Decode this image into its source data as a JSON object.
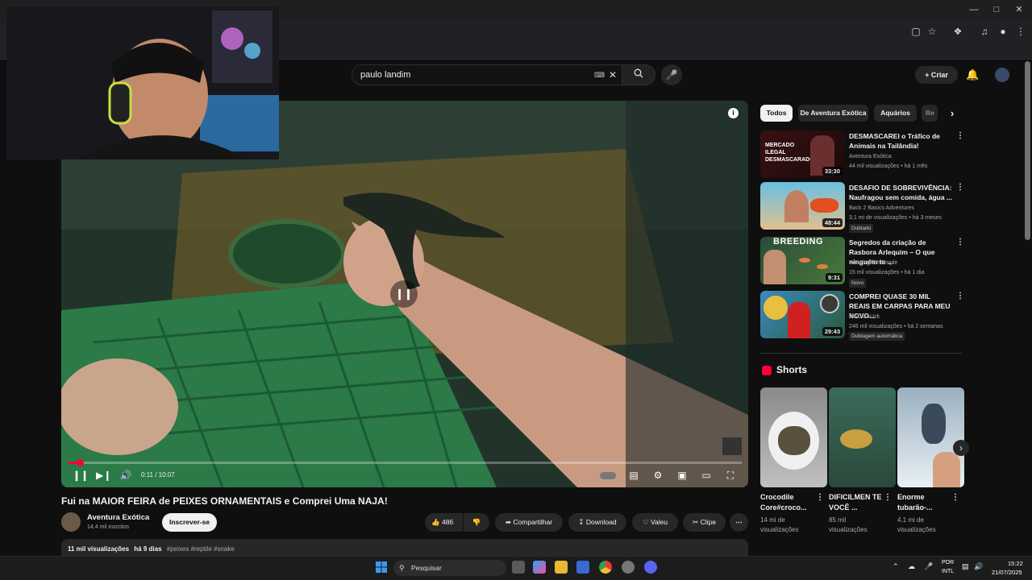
{
  "search": {
    "query": "paulo landim"
  },
  "header": {
    "create_label": "Criar"
  },
  "player": {
    "timecode": "0:11 / 10:07",
    "progress": 0.018
  },
  "video": {
    "title": "Fui na MAIOR FEIRA de PEIXES ORNAMENTAIS e Comprei Uma NAJA!",
    "channel": "Aventura Exótica",
    "subscribers": "14,4 mil inscritos",
    "subscribe_label": "Inscrever-se",
    "likes": "486",
    "share_label": "Compartilhar",
    "download_label": "Download",
    "thanks_label": "Valeu",
    "clip_label": "Clipe",
    "views": "11 mil visualizações",
    "age": "há 9 dias",
    "hashtags": "#peixes #reptile #snake"
  },
  "chips": [
    "Todos",
    "De Aventura Exótica",
    "Aquários",
    "Re"
  ],
  "recommendations": [
    {
      "title": "DESMASCAREI o Tráfico de Animais na Tailândia!",
      "channel": "Aventura Exótica",
      "meta": "44 mil visualizações • há 1 mês",
      "duration": "33:30",
      "badge": "",
      "thumb_text": "MERCADO ILEGAL DESMASCARADO"
    },
    {
      "title": "DESAFIO DE SOBREVIVÊNCIA: Naufragou sem comida, água ...",
      "channel": "Back 2 Basics Adventures",
      "meta": "3,1 mi de visualizações • há 3 meses",
      "duration": "48:44",
      "badge": "Dublado",
      "thumb_text": ""
    },
    {
      "title": "Segredos da criação de Rasbora Arlequim – O que ninguém te ...",
      "channel": "KeepingFishSimple",
      "meta": "15 mil visualizações • há 1 dia",
      "duration": "9:31",
      "badge": "Novo",
      "thumb_text": "BREEDING"
    },
    {
      "title": "COMPREI QUASE 30 MIL REAIS EM CARPAS PARA MEU NOVO...",
      "channel": "MAUMAUzk",
      "meta": "246 mil visualizações • há 2 semanas",
      "duration": "29:43",
      "badge": "Dublagem automática",
      "thumb_text": ""
    }
  ],
  "shorts": {
    "heading": "Shorts",
    "items": [
      {
        "title": "Crocodile Core#croco...",
        "views": "14 mi de visualizações"
      },
      {
        "title": "DIFICILMEN TE VOCÊ ...",
        "views": "85 mil visualizações"
      },
      {
        "title": "Enorme tubarão-...",
        "views": "4,1 mi de visualizações"
      }
    ]
  },
  "taskbar": {
    "search_label": "Pesquisar",
    "lang1": "POR",
    "lang2": "INTL",
    "time": "15:22",
    "date": "21/07/2025"
  },
  "colors": {
    "accent": "#ff0033",
    "background": "#0f0f0f",
    "surface": "#272727"
  }
}
